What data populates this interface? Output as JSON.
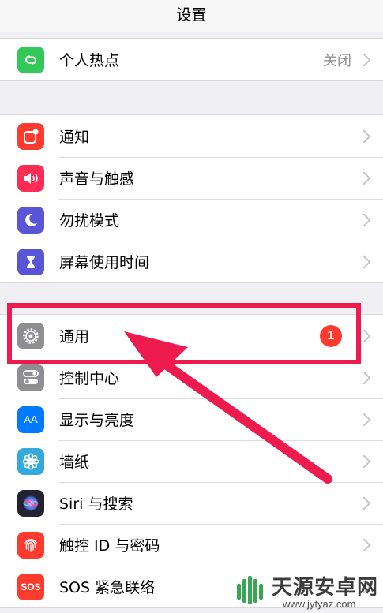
{
  "navbar": {
    "title": "设置"
  },
  "groups": [
    {
      "items": [
        {
          "label": "个人热点",
          "value": "关闭",
          "icon": "link-chain-icon",
          "color": "#34c759"
        }
      ]
    },
    {
      "items": [
        {
          "label": "通知",
          "icon": "notification-icon",
          "color": "#ff3b30"
        },
        {
          "label": "声音与触感",
          "icon": "speaker-icon",
          "color": "#ff2d55"
        },
        {
          "label": "勿扰模式",
          "icon": "moon-icon",
          "color": "#5856d6"
        },
        {
          "label": "屏幕使用时间",
          "icon": "hourglass-icon",
          "color": "#5856d6"
        }
      ]
    },
    {
      "items": [
        {
          "label": "通用",
          "icon": "gear-icon",
          "color": "#8e8e93",
          "badge": "1"
        },
        {
          "label": "控制中心",
          "icon": "toggle-switch-icon",
          "color": "#8e8e93"
        },
        {
          "label": "显示与亮度",
          "icon": "text-size-icon",
          "color": "#007aff",
          "icon_text": "AA"
        },
        {
          "label": "墙纸",
          "icon": "flower-icon",
          "color": "#34aadc"
        },
        {
          "label": "Siri 与搜索",
          "icon": "siri-icon",
          "color": "#222233"
        },
        {
          "label": "触控 ID 与密码",
          "icon": "fingerprint-icon",
          "color": "#ff3b30"
        },
        {
          "label": "SOS 紧急联络",
          "icon": "sos-icon",
          "color": "#ff3b30",
          "icon_text": "SOS"
        }
      ]
    }
  ],
  "annotation": {
    "highlight_color": "#ee1b4f"
  },
  "watermark": {
    "title": "天源安卓网",
    "url": "www.jytyaz.com"
  }
}
